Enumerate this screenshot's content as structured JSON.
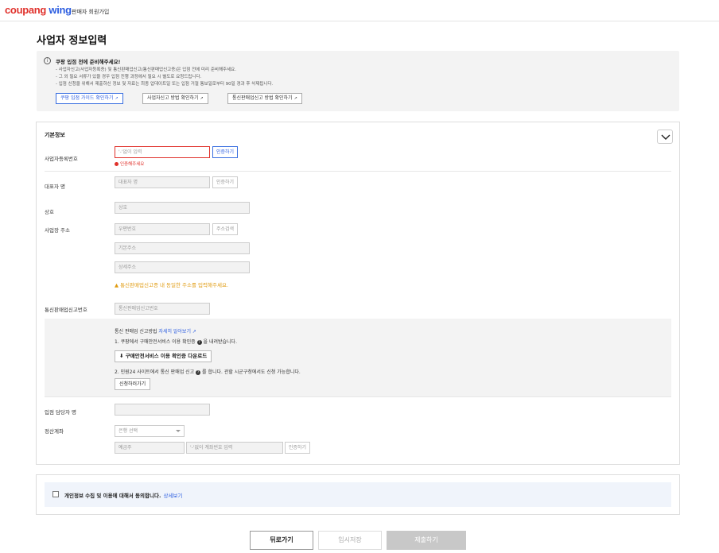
{
  "header": {
    "logo_part1": "coupang",
    "logo_part2": "wing",
    "subtitle": "판매자 회원가입"
  },
  "page": {
    "title": "사업자 정보입력"
  },
  "notice": {
    "icon": "info-icon",
    "title": "쿠팡 입점 전에 준비해주세요!",
    "lines": [
      "- 사업자신고(사업자등록증) 및 통신판매업신고(통신판매업신고증)은 입점 전에 미리 준비해주세요.",
      "- 그 외 필요 서류가 있을 경우 입점 진행 과정에서 필요 시 별도로 요청드립니다.",
      "- 입점 신청을 위해서 제출하신 정보 및 자료는 최종 업데이트일 또는 입점 거절 통보일로부터 90일 경과 후 삭제됩니다."
    ],
    "buttons": [
      "쿠팡 입점 가이드 확인하기",
      "사업자신고 방법 확인하기",
      "통신판매업신고 방법 확인하기"
    ]
  },
  "basic_info": {
    "section_title": "기본정보",
    "business_number": {
      "label": "사업자등록번호",
      "placeholder": "'-'없이 입력",
      "button": "인증하기",
      "error": "인증해주세요"
    },
    "representative": {
      "label": "대표자 명",
      "placeholder": "대표자 명",
      "button": "인증하기"
    },
    "company_name": {
      "label": "상호",
      "placeholder": "상호"
    },
    "address": {
      "label": "사업장 주소",
      "postal_placeholder": "우편번호",
      "search_button": "주소검색",
      "base_placeholder": "기본주소",
      "detail_placeholder": "상세주소",
      "warning": "통신판매업신고증 내 동일한 주소를 입력해주세요."
    },
    "ecommerce_number": {
      "label": "통신판매업신고번호",
      "placeholder": "통신판매업신고번호"
    },
    "guide": {
      "title": "통신 판매업 신고방법",
      "link": "자세히 알아보기",
      "step1": "1. 쿠팡에서 구매안전서비스 이용 확인증",
      "step1_suffix": "을 내려받습니다.",
      "download_button": "구매안전서비스 이용 확인증 다운로드",
      "step2": "2. 민원24 사이트에서 통신 판매업 신고",
      "step2_suffix": "를 합니다. 관할 시군구청에서도 신청 가능합니다.",
      "apply_button": "신청하러가기"
    },
    "manager": {
      "label": "입점 담당자 명"
    },
    "settlement": {
      "label": "정산계좌",
      "bank_select": "은행 선택",
      "holder_placeholder": "예금주",
      "account_placeholder": "'-'없이 계좌번호 입력",
      "button": "인증하기"
    }
  },
  "agreement": {
    "text": "개인정보 수집 및 이용에 대해서 동의합니다.",
    "link": "상세보기"
  },
  "footer": {
    "back": "뒤로가기",
    "save": "임시저장",
    "submit": "제출하기"
  }
}
